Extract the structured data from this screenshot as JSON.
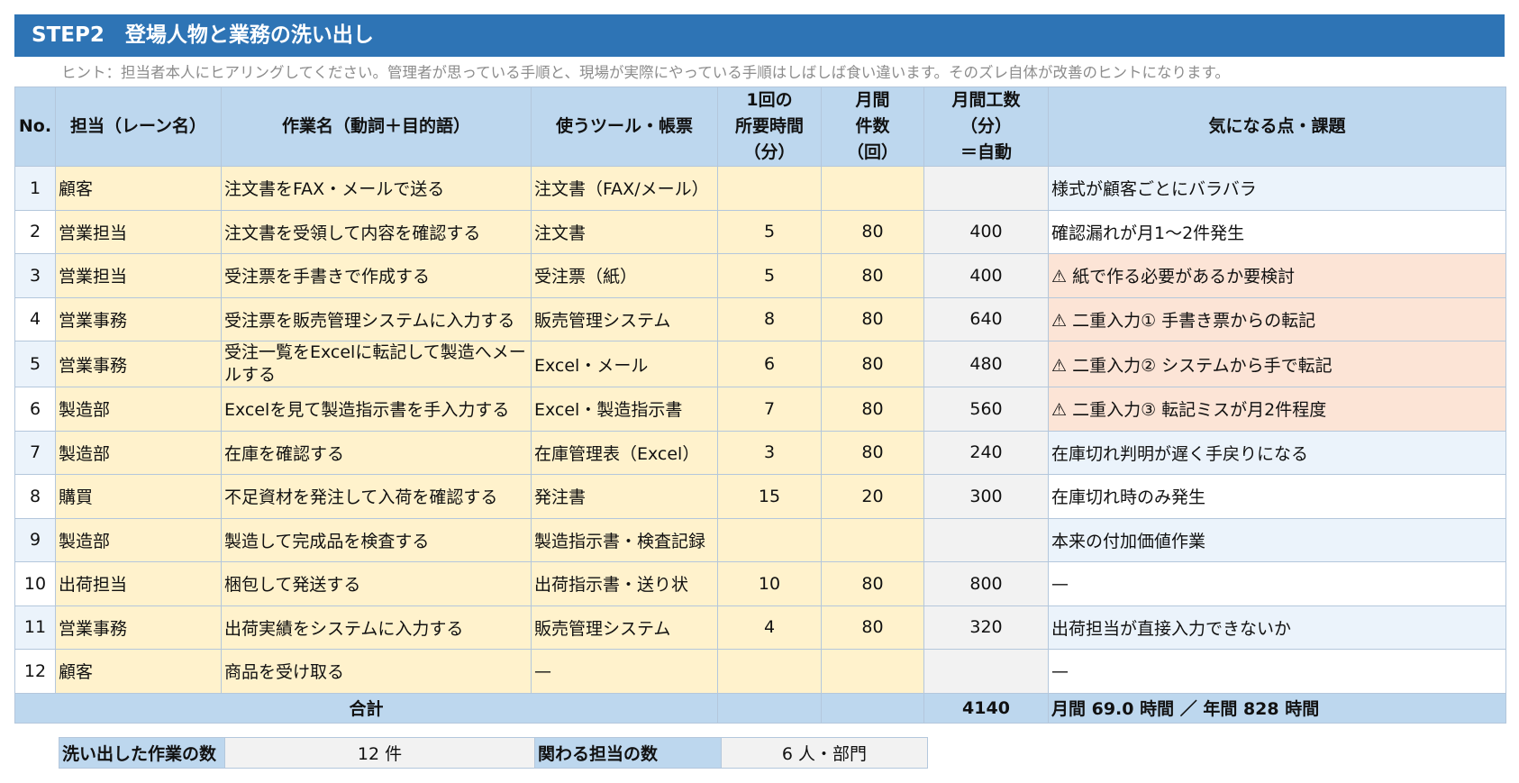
{
  "title": "STEP2　登場人物と業務の洗い出し",
  "hint": "ヒント：担当者本人にヒアリングしてください。管理者が思っている手順と、現場が実際にやっている手順はしばしば食い違います。そのズレ自体が改善のヒントになります。",
  "headers": {
    "no": "No.",
    "lane": "担当（レーン名）",
    "task": "作業名（動詞＋目的語）",
    "tool": "使うツール・帳票",
    "time_l1": "1回の",
    "time_l2": "所要時間",
    "time_l3": "（分）",
    "count_l1": "月間",
    "count_l2": "件数",
    "count_l3": "（回）",
    "mh_l1": "月間工数",
    "mh_l2": "（分）",
    "mh_l3": "＝自動",
    "issue": "気になる点・課題"
  },
  "rows": [
    {
      "no": "1",
      "lane": "顧客",
      "task": "注文書をFAX・メールで送る",
      "tool": "注文書（FAX/メール）",
      "time": "",
      "count": "",
      "mh": "",
      "issue": "様式が顧客ごとにバラバラ"
    },
    {
      "no": "2",
      "lane": "営業担当",
      "task": "注文書を受領して内容を確認する",
      "tool": "注文書",
      "time": "5",
      "count": "80",
      "mh": "400",
      "issue": "確認漏れが月1〜2件発生"
    },
    {
      "no": "3",
      "lane": "営業担当",
      "task": "受注票を手書きで作成する",
      "tool": "受注票（紙）",
      "time": "5",
      "count": "80",
      "mh": "400",
      "issue": "⚠ 紙で作る必要があるか要検討"
    },
    {
      "no": "4",
      "lane": "営業事務",
      "task": "受注票を販売管理システムに入力する",
      "tool": "販売管理システム",
      "time": "8",
      "count": "80",
      "mh": "640",
      "issue": "⚠ 二重入力① 手書き票からの転記"
    },
    {
      "no": "5",
      "lane": "営業事務",
      "task": "受注一覧をExcelに転記して製造へメールする",
      "tool": "Excel・メール",
      "time": "6",
      "count": "80",
      "mh": "480",
      "issue": "⚠ 二重入力② システムから手で転記"
    },
    {
      "no": "6",
      "lane": "製造部",
      "task": "Excelを見て製造指示書を手入力する",
      "tool": "Excel・製造指示書",
      "time": "7",
      "count": "80",
      "mh": "560",
      "issue": "⚠ 二重入力③ 転記ミスが月2件程度"
    },
    {
      "no": "7",
      "lane": "製造部",
      "task": "在庫を確認する",
      "tool": "在庫管理表（Excel）",
      "time": "3",
      "count": "80",
      "mh": "240",
      "issue": "在庫切れ判明が遅く手戻りになる"
    },
    {
      "no": "8",
      "lane": "購買",
      "task": "不足資材を発注して入荷を確認する",
      "tool": "発注書",
      "time": "15",
      "count": "20",
      "mh": "300",
      "issue": "在庫切れ時のみ発生"
    },
    {
      "no": "9",
      "lane": "製造部",
      "task": "製造して完成品を検査する",
      "tool": "製造指示書・検査記録",
      "time": "",
      "count": "",
      "mh": "",
      "issue": "本来の付加価値作業"
    },
    {
      "no": "10",
      "lane": "出荷担当",
      "task": "梱包して発送する",
      "tool": "出荷指示書・送り状",
      "time": "10",
      "count": "80",
      "mh": "800",
      "issue": "—"
    },
    {
      "no": "11",
      "lane": "営業事務",
      "task": "出荷実績をシステムに入力する",
      "tool": "販売管理システム",
      "time": "4",
      "count": "80",
      "mh": "320",
      "issue": "出荷担当が直接入力できないか"
    },
    {
      "no": "12",
      "lane": "顧客",
      "task": "商品を受け取る",
      "tool": "—",
      "time": "",
      "count": "",
      "mh": "",
      "issue": "—"
    }
  ],
  "total": {
    "label": "合計",
    "mh": "4140",
    "note": "月間 69.0 時間 ／ 年間 828 時間"
  },
  "summary": {
    "tasks_label": "洗い出した作業の数",
    "tasks_value": "12 件",
    "people_label": "関わる担当の数",
    "people_value": "6 人・部門"
  },
  "colors": {
    "title_bg": "#2e74b5",
    "header_bg": "#bdd7ee",
    "input_bg": "#fff2cc",
    "auto_bg": "#f2f2f2",
    "warn_bg": "#fce4d6",
    "issue_bg": "#ebf3fb"
  }
}
